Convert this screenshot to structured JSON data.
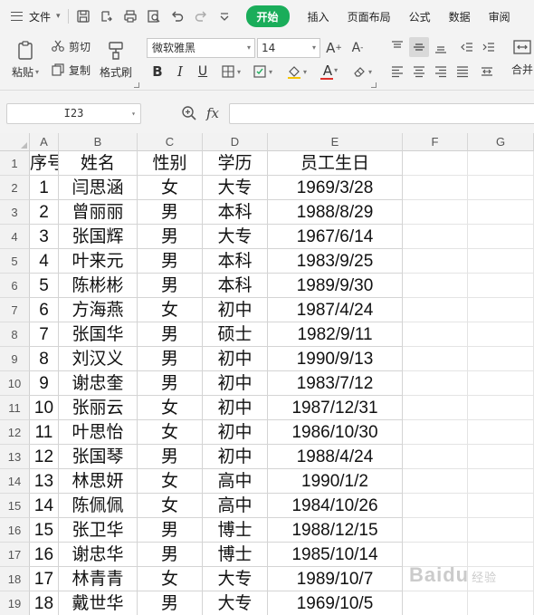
{
  "menu": {
    "file": "文件",
    "tabs": [
      {
        "label": "开始",
        "active": true
      },
      {
        "label": "插入",
        "active": false
      },
      {
        "label": "页面布局",
        "active": false
      },
      {
        "label": "公式",
        "active": false
      },
      {
        "label": "数据",
        "active": false
      },
      {
        "label": "审阅",
        "active": false
      }
    ]
  },
  "ribbon": {
    "paste": "粘贴",
    "cut": "剪切",
    "copy": "复制",
    "format_painter": "格式刷",
    "font_name": "微软雅黑",
    "font_size": "14",
    "merge": "合并"
  },
  "formula_bar": {
    "name_box": "I23",
    "fx": "fx",
    "formula": ""
  },
  "columns": [
    "A",
    "B",
    "C",
    "D",
    "E",
    "F",
    "G"
  ],
  "rows": [
    "1",
    "2",
    "3",
    "4",
    "5",
    "6",
    "7",
    "8",
    "9",
    "10",
    "11",
    "12",
    "13",
    "14",
    "15",
    "16",
    "17",
    "18",
    "19"
  ],
  "table": {
    "header": [
      "序号",
      "姓名",
      "性别",
      "学历",
      "员工生日"
    ],
    "body": [
      [
        "1",
        "闫思涵",
        "女",
        "大专",
        "1969/3/28"
      ],
      [
        "2",
        "曾丽丽",
        "男",
        "本科",
        "1988/8/29"
      ],
      [
        "3",
        "张国辉",
        "男",
        "大专",
        "1967/6/14"
      ],
      [
        "4",
        "叶来元",
        "男",
        "本科",
        "1983/9/25"
      ],
      [
        "5",
        "陈彬彬",
        "男",
        "本科",
        "1989/9/30"
      ],
      [
        "6",
        "方海燕",
        "女",
        "初中",
        "1987/4/24"
      ],
      [
        "7",
        "张国华",
        "男",
        "硕士",
        "1982/9/11"
      ],
      [
        "8",
        "刘汉义",
        "男",
        "初中",
        "1990/9/13"
      ],
      [
        "9",
        "谢忠奎",
        "男",
        "初中",
        "1983/7/12"
      ],
      [
        "10",
        "张丽云",
        "女",
        "初中",
        "1987/12/31"
      ],
      [
        "11",
        "叶思怡",
        "女",
        "初中",
        "1986/10/30"
      ],
      [
        "12",
        "张国琴",
        "男",
        "初中",
        "1988/4/24"
      ],
      [
        "13",
        "林思妍",
        "女",
        "高中",
        "1990/1/2"
      ],
      [
        "14",
        "陈佩佩",
        "女",
        "高中",
        "1984/10/26"
      ],
      [
        "15",
        "张卫华",
        "男",
        "博士",
        "1988/12/15"
      ],
      [
        "16",
        "谢忠华",
        "男",
        "博士",
        "1985/10/14"
      ],
      [
        "17",
        "林青青",
        "女",
        "大专",
        "1989/10/7"
      ],
      [
        "18",
        "戴世华",
        "男",
        "大专",
        "1969/10/5"
      ]
    ]
  },
  "colors": {
    "accent": "#1aad5a",
    "font_color_bar": "#e0302b"
  },
  "watermark": {
    "brand": "Baidu",
    "sub": "经验"
  }
}
